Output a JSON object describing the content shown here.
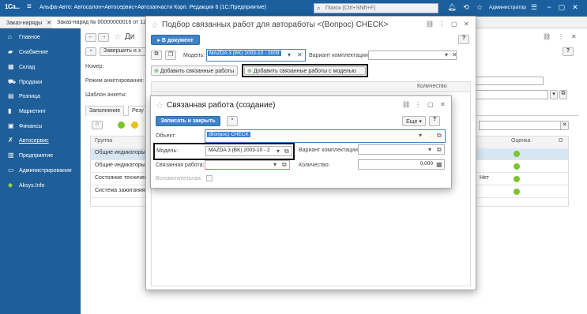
{
  "topbar": {
    "logo": "1Са...",
    "title": "Альфа-Авто: Автосалон+Автосервис+Автозапчасти Корп. Редакция 6  (1С:Предприятие)",
    "search_placeholder": "Поиск (Ctrl+Shift+F)",
    "user": "Администратор"
  },
  "tabs": {
    "t1": "Заказ-наряды",
    "t2": "Заказ-наряд № 00000000016 от 12..."
  },
  "sidebar": {
    "items": [
      "Главное",
      "Снабжение",
      "Склад",
      "Продажи",
      "Розница",
      "Маркетинг",
      "Финансы",
      "Автосервис",
      "Предприятие",
      "Администрирование",
      "Aksys.Info"
    ]
  },
  "doc": {
    "title_part": "Ди",
    "close_btn": "Завершить и з",
    "lbl_number": "Номер:",
    "lbl_mode": "Режим анкетирования:",
    "lbl_template": "Шаблон анкеты:",
    "tab_fill": "Заполнение",
    "tab_result": "Резу",
    "grid_header_group": "Группа",
    "grid_header_score": "Оценка",
    "grid_header_o": "О",
    "rows": [
      "Общие индикаторы",
      "Общие индикаторы",
      "Состояние техничес",
      "Система зажигания"
    ],
    "row_value_3": "Нет"
  },
  "dialog1": {
    "title": "Подбор связанных работ для автоработы <(Вопрос) CHECK>",
    "btn_to_doc": "В документ",
    "lbl_model": "Модель:",
    "model_value": "MAZDA 3 (BK) 2003-10 - 2009",
    "lbl_variant": "Вариант комплектации:",
    "btn_add_related": "Добавить связанные работы",
    "btn_add_related_model": "Добавить связанные работы с моделью",
    "col_quantity": "Количество"
  },
  "dialog2": {
    "title": "Связанная работа (создание)",
    "btn_save_close": "Записать и закрыть",
    "btn_more": "Еще",
    "btn_help": "?",
    "lbl_object": "Объект:",
    "object_value": "(Вопрос) CHECK",
    "lbl_model": "Модель:",
    "model_value": "MAZDA 3 (BK) 2003-10 - 2",
    "lbl_variant": "Вариант комплектации:",
    "lbl_related": "Связанная работа:",
    "lbl_quantity": "Количество:",
    "quantity_value": "0,000",
    "lbl_aux": "Вспомогательная:"
  },
  "colors": {
    "topbar": "#1b5f9e",
    "sidebar": "#1f5f99",
    "accent": "#3f82c5",
    "ok_dot": "#7bc62b"
  }
}
